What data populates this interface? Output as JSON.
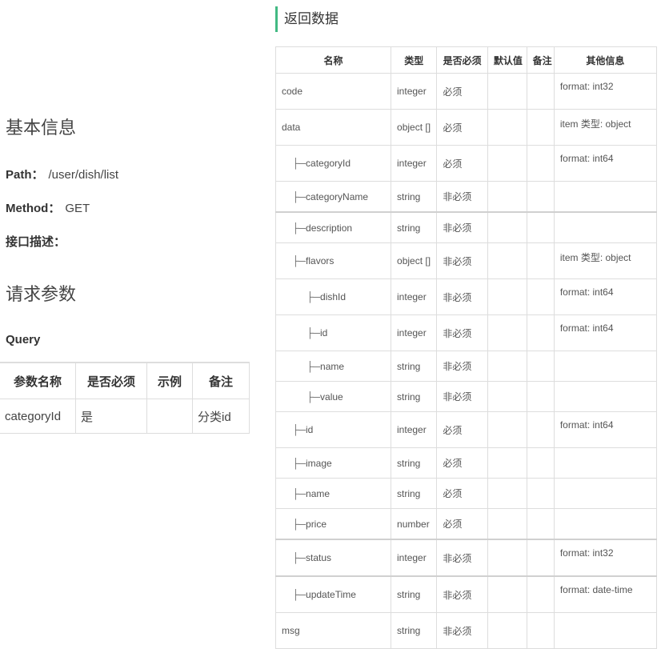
{
  "left": {
    "basic_title": "基本信息",
    "path_label": "Path：",
    "path_value": "/user/dish/list",
    "method_label": "Method：",
    "method_value": "GET",
    "desc_label": "接口描述：",
    "params_title": "请求参数",
    "query_label": "Query",
    "query_table": {
      "headers": [
        "参数名称",
        "是否必须",
        "示例",
        "备注"
      ],
      "rows": [
        [
          "categoryId",
          "是",
          "",
          "分类id"
        ]
      ]
    }
  },
  "right": {
    "return_title": "返回数据",
    "tree_prefix": "├─",
    "headers": [
      "名称",
      "类型",
      "是否必须",
      "默认值",
      "备注",
      "其他信息"
    ],
    "rows": [
      {
        "name": "code",
        "level": 0,
        "type": "integer",
        "required": "必须",
        "other": "format: int32"
      },
      {
        "name": "data",
        "level": 0,
        "type": "object []",
        "required": "必须",
        "other": "item 类型: object"
      },
      {
        "name": "categoryId",
        "level": 1,
        "type": "integer",
        "required": "必须",
        "other": "format: int64"
      },
      {
        "name": "categoryName",
        "level": 1,
        "type": "string",
        "required": "非必须",
        "other": ""
      },
      {
        "name": "description",
        "level": 1,
        "type": "string",
        "required": "非必须",
        "other": ""
      },
      {
        "name": "flavors",
        "level": 1,
        "type": "object []",
        "required": "非必须",
        "other": "item 类型: object"
      },
      {
        "name": "dishId",
        "level": 2,
        "type": "integer",
        "required": "非必须",
        "other": "format: int64"
      },
      {
        "name": "id",
        "level": 2,
        "type": "integer",
        "required": "非必须",
        "other": "format: int64"
      },
      {
        "name": "name",
        "level": 2,
        "type": "string",
        "required": "非必须",
        "other": ""
      },
      {
        "name": "value",
        "level": 2,
        "type": "string",
        "required": "非必须",
        "other": ""
      },
      {
        "name": "id",
        "level": 1,
        "type": "integer",
        "required": "必须",
        "other": "format: int64"
      },
      {
        "name": "image",
        "level": 1,
        "type": "string",
        "required": "必须",
        "other": ""
      },
      {
        "name": "name",
        "level": 1,
        "type": "string",
        "required": "必须",
        "other": ""
      },
      {
        "name": "price",
        "level": 1,
        "type": "number",
        "required": "必须",
        "other": ""
      },
      {
        "name": "status",
        "level": 1,
        "type": "integer",
        "required": "非必须",
        "other": "format: int32"
      },
      {
        "name": "updateTime",
        "level": 1,
        "type": "string",
        "required": "非必须",
        "other": "format: date-time"
      },
      {
        "name": "msg",
        "level": 0,
        "type": "string",
        "required": "非必须",
        "other": ""
      }
    ]
  }
}
